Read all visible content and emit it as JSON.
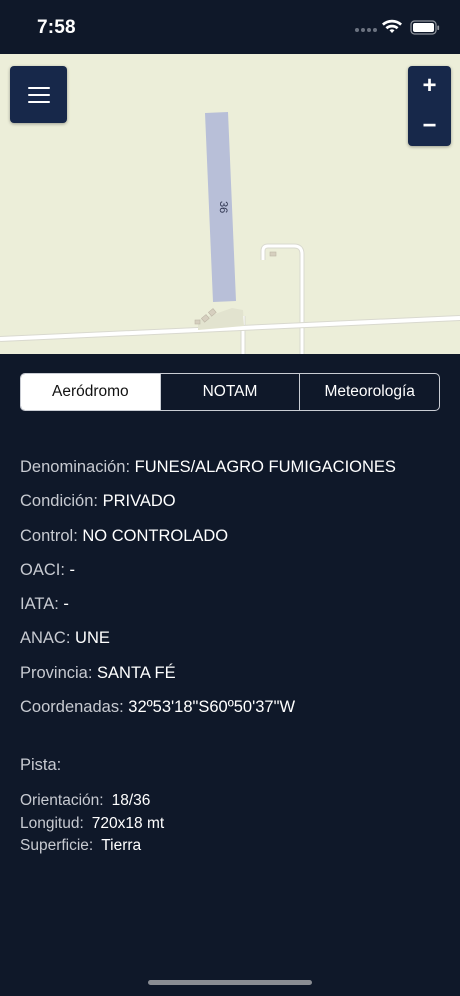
{
  "status_bar": {
    "time": "7:58",
    "icons": [
      "signal-dots-icon",
      "wifi-icon",
      "battery-icon"
    ]
  },
  "map": {
    "runway_label": "36",
    "colors": {
      "land": "#eceed9",
      "runway": "#b8bfd8",
      "road": "#ffffff"
    }
  },
  "map_controls": {
    "menu_icon": "hamburger-menu-icon",
    "zoom_in": "+",
    "zoom_out": "−"
  },
  "tabs": [
    {
      "label": "Aeródromo",
      "active": true
    },
    {
      "label": "NOTAM",
      "active": false
    },
    {
      "label": "Meteorología",
      "active": false
    }
  ],
  "info": {
    "denominacion": {
      "label": "Denominación:",
      "value": "FUNES/ALAGRO FUMIGACIONES"
    },
    "condicion": {
      "label": "Condición:",
      "value": "PRIVADO"
    },
    "control": {
      "label": "Control:",
      "value": "NO CONTROLADO"
    },
    "oaci": {
      "label": "OACI:",
      "value": "-"
    },
    "iata": {
      "label": "IATA:",
      "value": "-"
    },
    "anac": {
      "label": "ANAC:",
      "value": "UNE"
    },
    "provincia": {
      "label": "Provincia:",
      "value": "SANTA FÉ"
    },
    "coordenadas": {
      "label": "Coordenadas:",
      "value": "32º53'18\"S60º50'37\"W"
    }
  },
  "pista": {
    "title": "Pista:",
    "orientacion": {
      "label": "Orientación:",
      "value": "18/36"
    },
    "longitud": {
      "label": "Longitud:",
      "value": "720x18 mt"
    },
    "superficie": {
      "label": "Superficie:",
      "value": "Tierra"
    }
  },
  "theme": {
    "background": "#0f1829",
    "button": "#17284a",
    "label_color": "#c7cad1"
  }
}
